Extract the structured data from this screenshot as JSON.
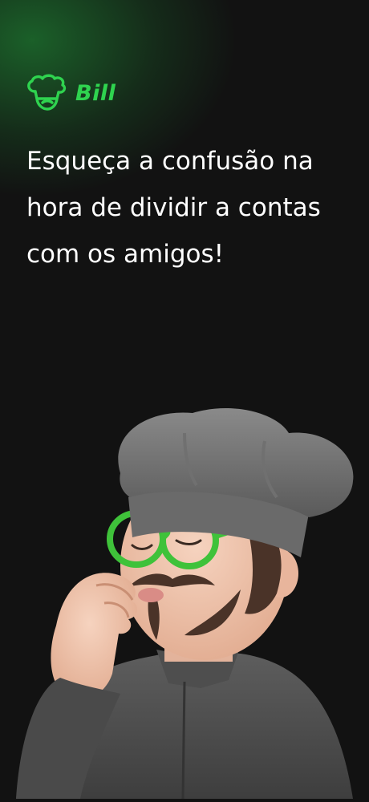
{
  "brand": {
    "name": "Bill",
    "color": "#2fd34f",
    "icon": "chef-hat-icon"
  },
  "headline": "Esqueça a confusão na hora de dividir a contas com os amigos!",
  "illustration": "chef-avatar-illustration",
  "colors": {
    "background": "#121212",
    "accent": "#2fd34f",
    "text": "#ffffff"
  }
}
